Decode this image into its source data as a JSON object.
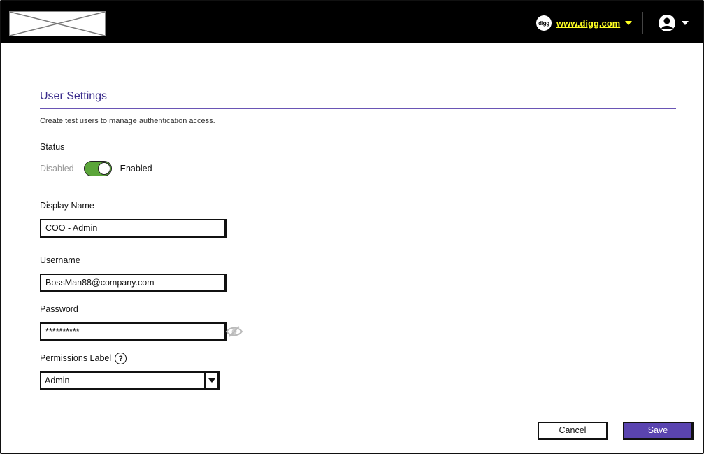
{
  "header": {
    "site_icon_text": "digg",
    "site_link": "www.digg.com"
  },
  "page": {
    "title": "User Settings",
    "description": "Create test users to manage authentication access."
  },
  "status": {
    "label": "Status",
    "off_label": "Disabled",
    "on_label": "Enabled",
    "enabled": true
  },
  "display_name": {
    "label": "Display Name",
    "value": "COO - Admin"
  },
  "username": {
    "label": "Username",
    "value": "BossMan88@company.com"
  },
  "password": {
    "label": "Password",
    "value": "**********"
  },
  "permissions": {
    "label": "Permissions Label",
    "help_icon": "?",
    "selected": "Admin"
  },
  "actions": {
    "cancel_label": "Cancel",
    "save_label": "Save"
  },
  "colors": {
    "accent": "#5a44b0",
    "title": "#3a2c8c",
    "toggle_on": "#5ba53a",
    "link": "#ffff22",
    "topbar": "#000000"
  },
  "icons": {
    "logo": "logo-placeholder-icon",
    "site": "digg-icon",
    "user": "user-avatar-icon",
    "password_visibility": "eye-hidden-icon"
  }
}
